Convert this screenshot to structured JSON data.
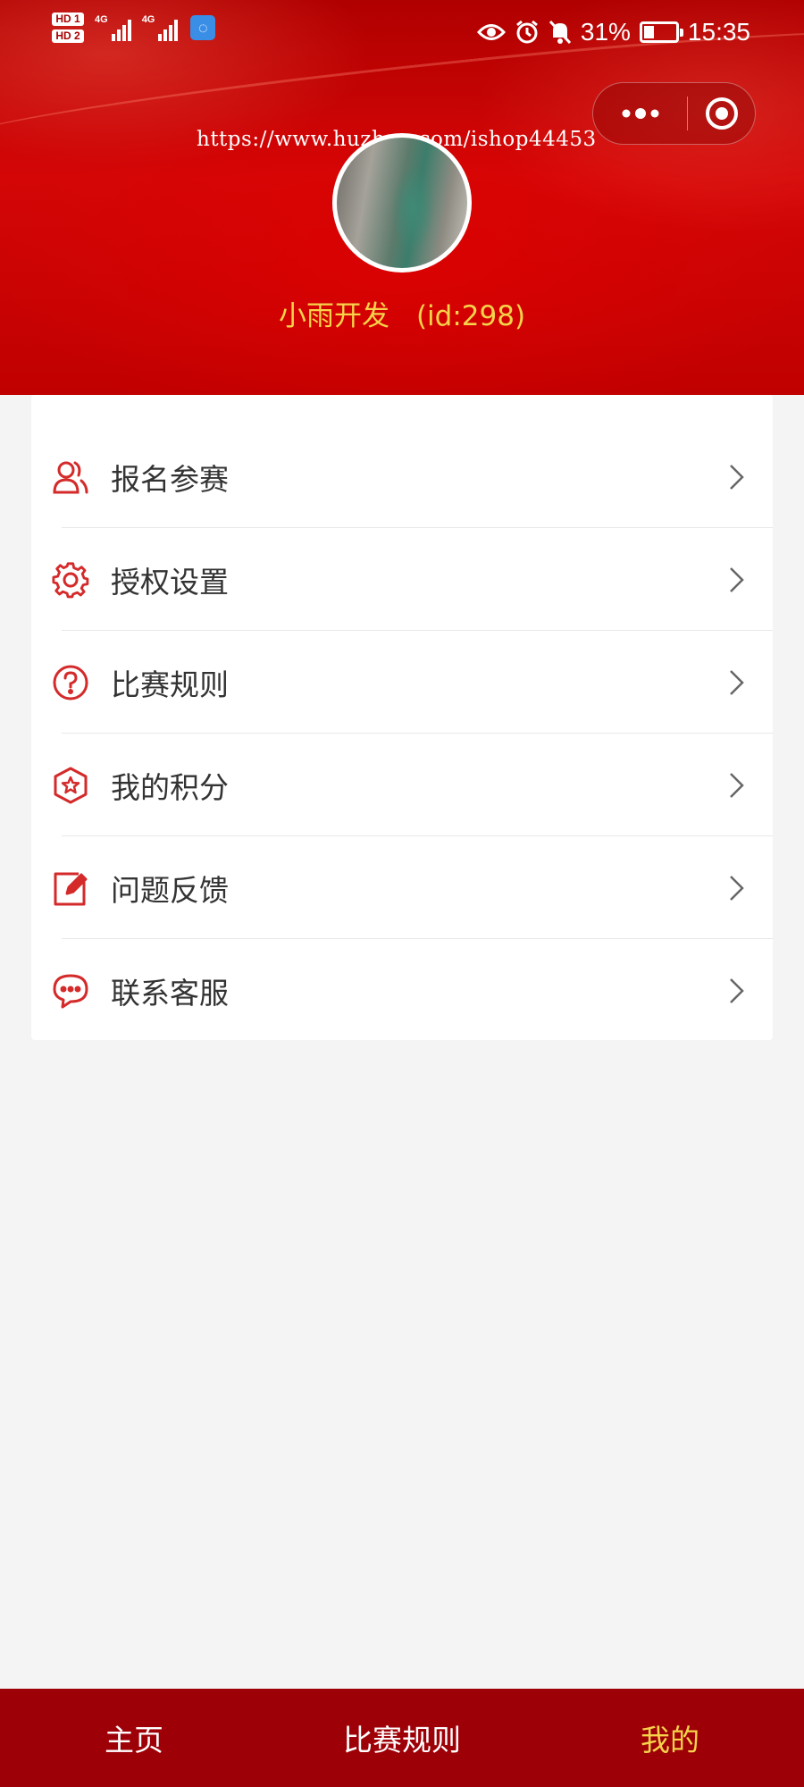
{
  "status_bar": {
    "sim1": "HD 1",
    "sim2": "HD 2",
    "net1": "4G",
    "net2": "4G",
    "battery_percent": "31%",
    "battery_level": 0.31,
    "time": "15:35"
  },
  "watermark": "https://www.huzhan.com/ishop44453",
  "profile": {
    "name": "小雨开发",
    "id_text": "(id:298)"
  },
  "menu": {
    "items": [
      {
        "label": "报名参赛",
        "icon": "people-icon"
      },
      {
        "label": "授权设置",
        "icon": "gear-icon"
      },
      {
        "label": "比赛规则",
        "icon": "question-icon"
      },
      {
        "label": "我的积分",
        "icon": "star-hexagon-icon"
      },
      {
        "label": "问题反馈",
        "icon": "edit-icon"
      },
      {
        "label": "联系客服",
        "icon": "chat-icon"
      }
    ]
  },
  "tabbar": {
    "tabs": [
      {
        "label": "主页",
        "active": false
      },
      {
        "label": "比赛规则",
        "active": false
      },
      {
        "label": "我的",
        "active": true
      }
    ]
  },
  "colors": {
    "primary_red": "#d40606",
    "tabbar_red": "#9d0007",
    "accent_yellow": "#f6d34a",
    "icon_red": "#d42a2a"
  }
}
